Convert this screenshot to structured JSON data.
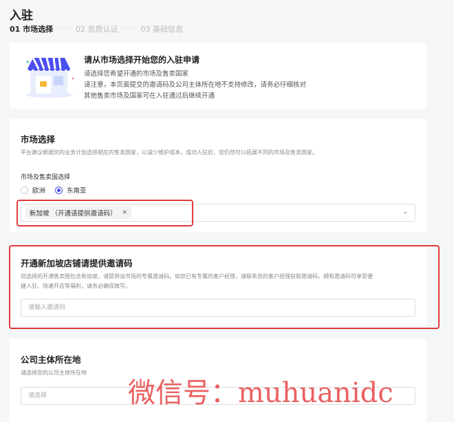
{
  "header": {
    "title": "入驻"
  },
  "steps": [
    {
      "label": "01 市场选择",
      "active": true
    },
    {
      "label": "02 资质认证",
      "active": false
    },
    {
      "label": "03 基础信息",
      "active": false
    }
  ],
  "step_separator": "·····",
  "intro": {
    "illustration": "shop-storefront-icon",
    "title": "请从市场选择开始您的入驻申请",
    "line1": "请选择您希望开通的市场及售卖国家",
    "line2": "请注意，本页面提交的邀请码及公司主体所在地不支持修改，请务必仔细核对",
    "line3": "其他售卖市场及国家可在入驻通过后继续开通"
  },
  "market": {
    "title": "市场选择",
    "desc": "平台建议根据您的业务计划选择相应的售卖国家，以减少维护成本。成功入驻后，您仍然可以拓展不同的市场及售卖国家。",
    "label": "市场及售卖国选择",
    "options": [
      {
        "label": "欧洲",
        "checked": false
      },
      {
        "label": "东南亚",
        "checked": true
      }
    ],
    "selected_tag": "新加坡 （开通请提供邀请码）",
    "tag_close": "×",
    "chevron": "⌄"
  },
  "invite": {
    "title": "开通新加坡店铺请提供邀请码",
    "desc_line1": "您选择的开通售卖国包含新加坡，请提供该市场的专属邀请码。如您已有专属的客户经理，请联系您的客户经理获取邀请码。拥有邀请码可享受便",
    "desc_line2": "捷入驻、快速开店等福利，请务必确保填写。",
    "placeholder": "请输入邀请码"
  },
  "entity": {
    "title": "公司主体所在地",
    "desc": "请选择您的公司主体所在地",
    "placeholder": "请选择"
  },
  "watermark": "微信号：muhuanidc",
  "colors": {
    "accent": "#4a4ff0",
    "highlight_red": "#e03a3a"
  }
}
